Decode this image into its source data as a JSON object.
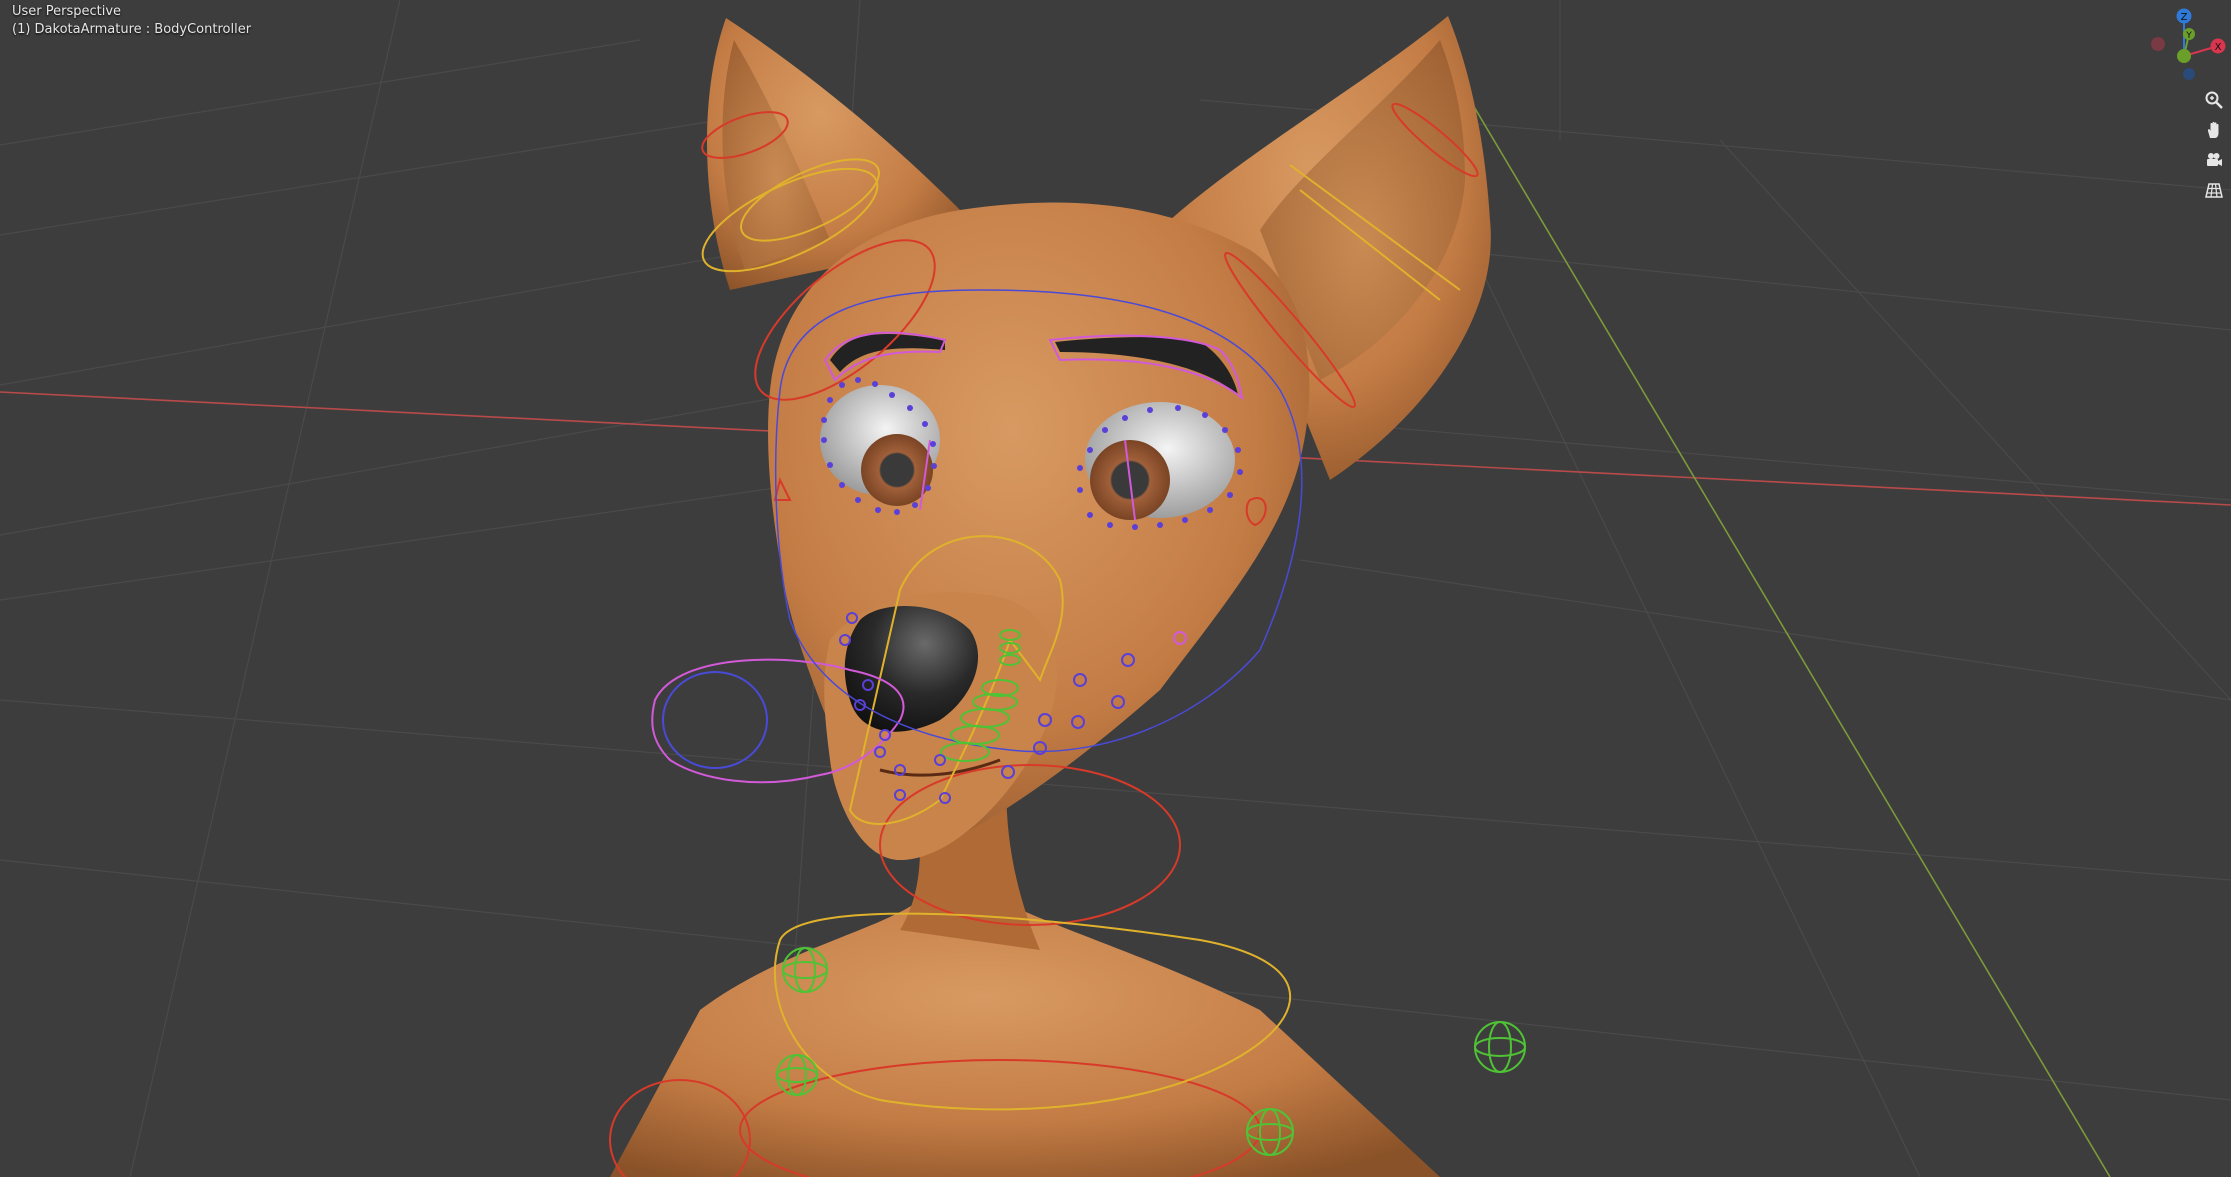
{
  "viewport": {
    "view_name": "User Perspective",
    "active_object": "(1) DakotaArmature : BodyController"
  },
  "gizmo": {
    "axes": [
      {
        "label": "Z",
        "color": "#2f7ad8"
      },
      {
        "label": "Y",
        "color": "#6a9f2a"
      },
      {
        "label": "X",
        "color": "#d8354f"
      }
    ]
  },
  "nav_buttons": [
    {
      "name": "zoom",
      "icon": "magnifier-icon"
    },
    {
      "name": "pan",
      "icon": "hand-icon"
    },
    {
      "name": "camera",
      "icon": "camera-icon"
    },
    {
      "name": "perspective",
      "icon": "grid-icon"
    }
  ],
  "colors": {
    "background": "#3d3d3d",
    "grid": "#4a4a4a",
    "x_axis": "#b84a4a",
    "y_axis": "#7b9a3a",
    "skin": "#c8834e",
    "bone_yellow": "#e0b22c",
    "bone_red": "#d83a2a",
    "bone_magenta": "#d25ad8",
    "bone_blue": "#4a4ad8",
    "bone_green": "#4fc235"
  }
}
